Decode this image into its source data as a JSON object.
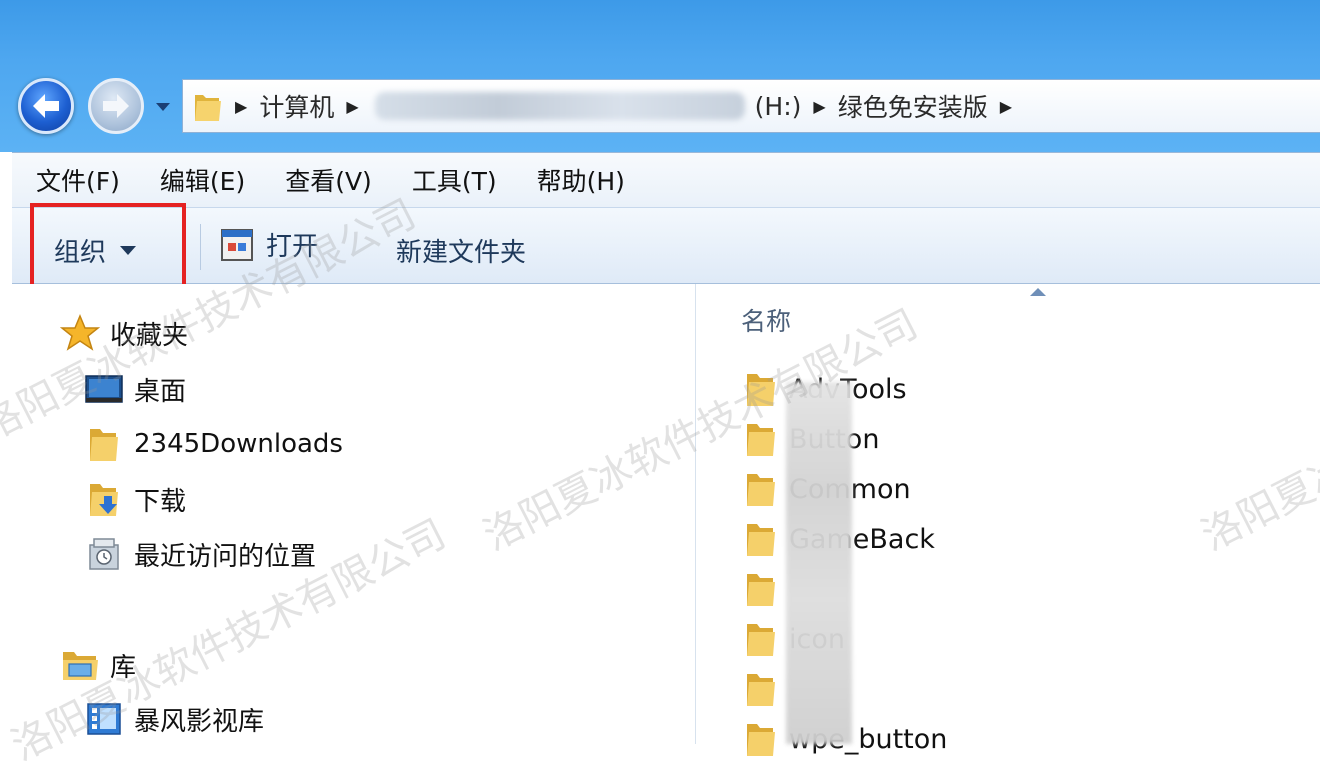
{
  "address_bar": {
    "segments": [
      "计算机",
      "(H:)",
      "绿色免安装版"
    ]
  },
  "menu": {
    "items": [
      "文件(F)",
      "编辑(E)",
      "查看(V)",
      "工具(T)",
      "帮助(H)"
    ]
  },
  "toolbar": {
    "organize_label": "组织",
    "open_label": "打开",
    "new_folder_label": "新建文件夹"
  },
  "navigation": {
    "favorites_label": "收藏夹",
    "favorites_items": [
      "桌面",
      "2345Downloads",
      "下载",
      "最近访问的位置"
    ],
    "libraries_label": "库",
    "libraries_items": [
      "暴风影视库"
    ]
  },
  "content": {
    "column_header": "名称",
    "files": [
      "AdvTools",
      "Button",
      "Common",
      "GameBack",
      "",
      "icon",
      "",
      "wpe_button"
    ]
  },
  "watermark": {
    "texts": [
      "洛阳夏冰软件技术有限公司",
      "洛阳夏冰软件技术有限公司",
      "洛阳夏冰",
      "洛阳夏冰软件技术有限公司"
    ]
  },
  "colors": {
    "highlight": "#e52222",
    "titlebar": "#4ea7f0",
    "toolbar_text": "#1e395b"
  }
}
